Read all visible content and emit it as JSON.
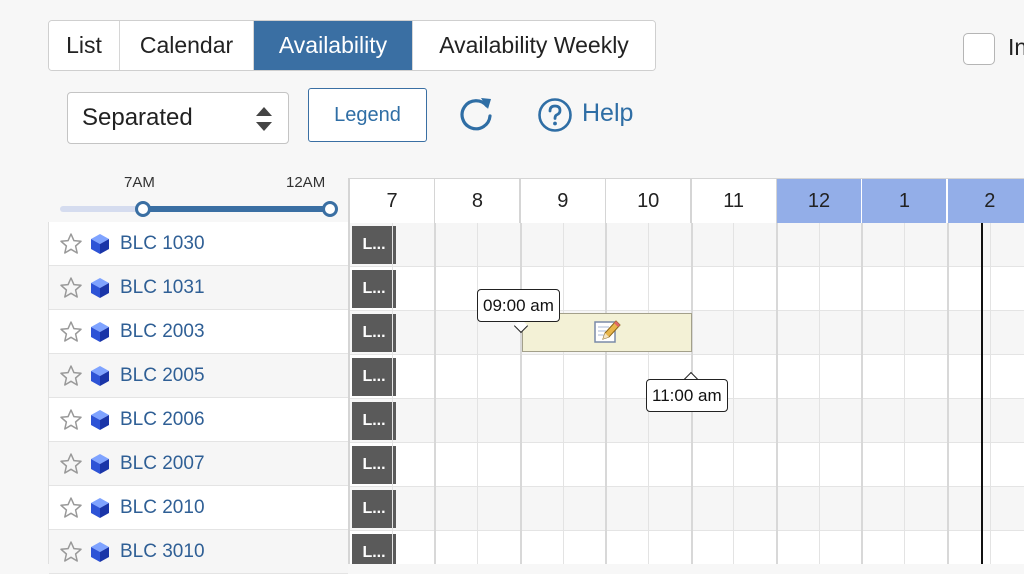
{
  "tabs": [
    {
      "label": "List",
      "active": false
    },
    {
      "label": "Calendar",
      "active": false
    },
    {
      "label": "Availability",
      "active": true
    },
    {
      "label": "Availability Weekly",
      "active": false
    }
  ],
  "top_right": {
    "checkbox_label": "In"
  },
  "toolbar": {
    "view_select_value": "Separated",
    "legend_label": "Legend",
    "help_label": "Help"
  },
  "time_range": {
    "start_label": "7AM",
    "end_label": "12AM"
  },
  "hours": [
    "7",
    "8",
    "9",
    "10",
    "11",
    "12",
    "1",
    "2"
  ],
  "rooms": [
    {
      "name": "BLC 1030",
      "block_label": "L..."
    },
    {
      "name": "BLC 1031",
      "block_label": "L..."
    },
    {
      "name": "BLC 2003",
      "block_label": "L..."
    },
    {
      "name": "BLC 2005",
      "block_label": "L..."
    },
    {
      "name": "BLC 2006",
      "block_label": "L..."
    },
    {
      "name": "BLC 2007",
      "block_label": "L..."
    },
    {
      "name": "BLC 2010",
      "block_label": "L..."
    },
    {
      "name": "BLC 3010",
      "block_label": "L..."
    }
  ],
  "selection": {
    "room": "BLC 2003",
    "start_tooltip": "09:00 am",
    "end_tooltip": "11:00 am"
  },
  "colors": {
    "accent": "#3a6fa3",
    "shaded_hour": "#93aee8",
    "booking_fill": "#f3f1d6",
    "block_fill": "#5a5a5a"
  }
}
